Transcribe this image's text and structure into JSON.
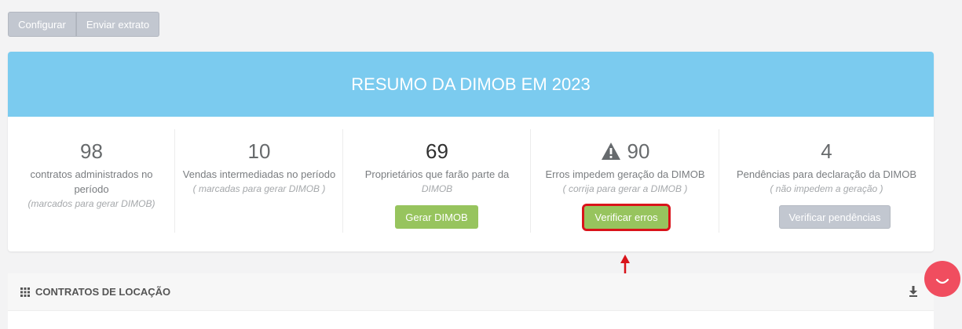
{
  "toolbar": {
    "configure_label": "Configurar",
    "send_label": "Enviar extrato"
  },
  "summary": {
    "title": "RESUMO DA DIMOB EM 2023",
    "columns": [
      {
        "value": "98",
        "label": "contratos administrados no período",
        "note": "(marcados para gerar DIMOB)"
      },
      {
        "value": "10",
        "label": "Vendas intermediadas no período",
        "note": "( marcadas para gerar DIMOB )"
      },
      {
        "value": "69",
        "label": "Proprietários que farão parte da",
        "note": "DIMOB",
        "button": "Gerar DIMOB"
      },
      {
        "value": "90",
        "label": "Erros impedem geração da DIMOB",
        "note": "( corrija para gerar a DIMOB )",
        "button": "Verificar erros",
        "icon": "warning-icon"
      },
      {
        "value": "4",
        "label": "Pendências para declaração da DIMOB",
        "note": "( não impedem a geração )",
        "button": "Verificar pendências"
      }
    ]
  },
  "contracts": {
    "title": "CONTRATOS DE LOCAÇÃO"
  },
  "colors": {
    "header_bg": "#7bcbef",
    "green_button": "#97c45e",
    "gray_button": "#c2c7d0",
    "highlight_border": "#d9131a",
    "chat_bubble": "#f04d5f"
  }
}
